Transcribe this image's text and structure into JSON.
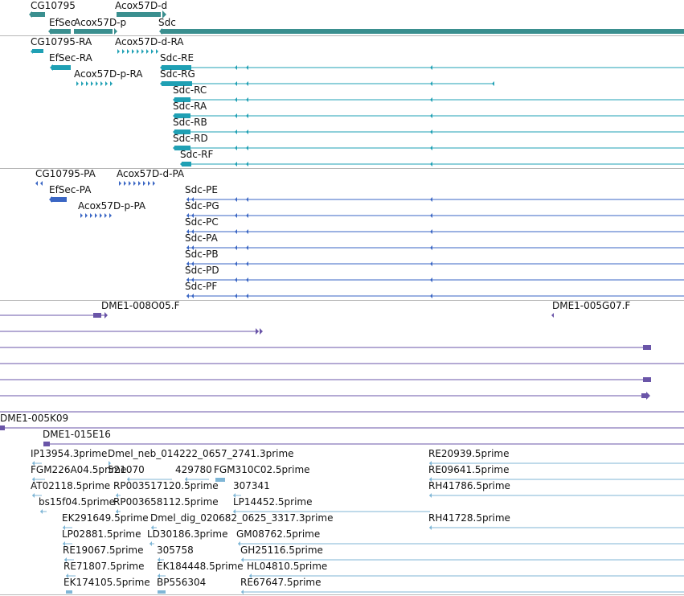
{
  "colors": {
    "gene": "#3a8f8f",
    "transcript_mrna": "#1fa0b4",
    "protein": "#3a66c4",
    "insertion": "#6a55a8",
    "est": "#7fb6d6",
    "separator": "#b8b8b8"
  },
  "tracks": [
    {
      "id": "genes",
      "color_key": "gene",
      "features": [
        {
          "label": "CG10795"
        },
        {
          "label": "Acox57D-d"
        },
        {
          "label": "EfSec"
        },
        {
          "label": "Acox57D-p"
        },
        {
          "label": "Sdc"
        }
      ]
    },
    {
      "id": "transcripts",
      "color_key": "transcript_mrna",
      "features": [
        {
          "label": "CG10795-RA"
        },
        {
          "label": "Acox57D-d-RA"
        },
        {
          "label": "EfSec-RA"
        },
        {
          "label": "Sdc-RE"
        },
        {
          "label": "Acox57D-p-RA"
        },
        {
          "label": "Sdc-RG"
        },
        {
          "label": "Sdc-RC"
        },
        {
          "label": "Sdc-RA"
        },
        {
          "label": "Sdc-RB"
        },
        {
          "label": "Sdc-RD"
        },
        {
          "label": "Sdc-RF"
        }
      ]
    },
    {
      "id": "proteins",
      "color_key": "protein",
      "features": [
        {
          "label": "CG10795-PA"
        },
        {
          "label": "Acox57D-d-PA"
        },
        {
          "label": "EfSec-PA"
        },
        {
          "label": "Sdc-PE"
        },
        {
          "label": "Acox57D-p-PA"
        },
        {
          "label": "Sdc-PG"
        },
        {
          "label": "Sdc-PC"
        },
        {
          "label": "Sdc-PA"
        },
        {
          "label": "Sdc-PB"
        },
        {
          "label": "Sdc-PD"
        },
        {
          "label": "Sdc-PF"
        }
      ]
    },
    {
      "id": "insertions",
      "color_key": "insertion",
      "features": [
        {
          "label": "DME1-008O05.F"
        },
        {
          "label": "DME1-005G07.F"
        },
        {
          "label": "DME1-005K09"
        },
        {
          "label": "DME1-015E16"
        }
      ]
    },
    {
      "id": "ests",
      "color_key": "est",
      "features": [
        {
          "label": "IP13954.3prime"
        },
        {
          "label": "Dmel_neb_014222_0657_2741.3prime"
        },
        {
          "label": "RE20939.5prime"
        },
        {
          "label": "FGM226A04.5prime"
        },
        {
          "label": "521070"
        },
        {
          "label": "429780"
        },
        {
          "label": "FGM310C02.5prime"
        },
        {
          "label": "RE09641.5prime"
        },
        {
          "label": "AT02118.5prime"
        },
        {
          "label": "RP003517120.5prime"
        },
        {
          "label": "307341"
        },
        {
          "label": "RH41786.5prime"
        },
        {
          "label": "bs15f04.5prime"
        },
        {
          "label": "RP003658112.5prime"
        },
        {
          "label": "LP14452.5prime"
        },
        {
          "label": "EK291649.5prime"
        },
        {
          "label": "Dmel_dig_020682_0625_3317.3prime"
        },
        {
          "label": "RH41728.5prime"
        },
        {
          "label": "LP02881.5prime"
        },
        {
          "label": "LD30186.3prime"
        },
        {
          "label": "GM08762.5prime"
        },
        {
          "label": "RE19067.5prime"
        },
        {
          "label": "305758"
        },
        {
          "label": "GH25116.5prime"
        },
        {
          "label": "RE71807.5prime"
        },
        {
          "label": "EK184448.5prime"
        },
        {
          "label": "HL04810.5prime"
        },
        {
          "label": "EK174105.5prime"
        },
        {
          "label": "BP556304"
        },
        {
          "label": "RE67647.5prime"
        }
      ]
    }
  ]
}
